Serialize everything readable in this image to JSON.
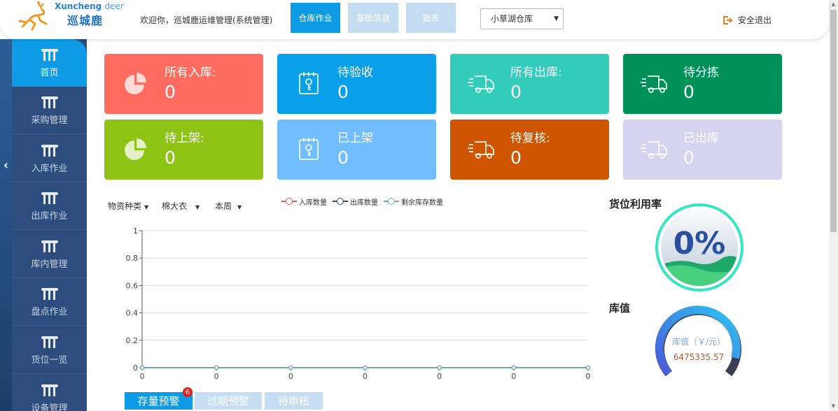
{
  "header": {
    "logo_en": "Xuncheng",
    "logo_en2": "deer",
    "logo_cn": "巡城鹿",
    "welcome": "欢迎你，巡城鹿运维管理(系统管理)",
    "nav": [
      "仓库作业",
      "基础信息",
      "报表"
    ],
    "warehouse": "小草湖仓库",
    "logout": "安全退出"
  },
  "sidebar": {
    "items": [
      "首页",
      "采购管理",
      "入库作业",
      "出库作业",
      "库内管理",
      "盘点作业",
      "货位一览",
      "设备管理"
    ]
  },
  "cards": [
    {
      "label": "所有入库:",
      "value": "0",
      "color": "#ff6b5e",
      "icon": "pie-chart-icon"
    },
    {
      "label": "待验收",
      "value": "0",
      "color": "#0aa0e9",
      "icon": "clipboard-key-icon"
    },
    {
      "label": "所有出库:",
      "value": "0",
      "color": "#33ccbb",
      "icon": "truck-icon"
    },
    {
      "label": "待分拣",
      "value": "0",
      "color": "#00905a",
      "icon": "truck-icon"
    },
    {
      "label": "待上架:",
      "value": "0",
      "color": "#8cc314",
      "icon": "pie-chart-icon"
    },
    {
      "label": "已上架",
      "value": "0",
      "color": "#70bdff",
      "icon": "clipboard-key-icon"
    },
    {
      "label": "待复核:",
      "value": "0",
      "color": "#cf5500",
      "icon": "truck-icon"
    },
    {
      "label": "已出库",
      "value": "0",
      "color": "#d6d3f0",
      "icon": "truck-icon"
    }
  ],
  "filters": {
    "category": "物资种类",
    "item": "棉大衣",
    "period": "本周"
  },
  "chart_data": {
    "type": "line",
    "x": [
      "0",
      "0",
      "0",
      "0",
      "0",
      "0",
      "0"
    ],
    "series": [
      {
        "name": "入库数量",
        "values": [
          0,
          0,
          0,
          0,
          0,
          0,
          0
        ],
        "color": "#e05555"
      },
      {
        "name": "出库数量",
        "values": [
          0,
          0,
          0,
          0,
          0,
          0,
          0
        ],
        "color": "#3a4a66"
      },
      {
        "name": "剩余库存数量",
        "values": [
          0,
          0,
          0,
          0,
          0,
          0,
          0
        ],
        "color": "#6aa9b5"
      }
    ],
    "yticks": [
      "0",
      "0.2",
      "0.4",
      "0.6",
      "0.8",
      "1"
    ],
    "ylim": [
      0,
      1
    ],
    "grid": true,
    "legend": "top"
  },
  "bottom_tabs": {
    "items": [
      "存量预警",
      "过期预警",
      "待审核"
    ],
    "badge": "6"
  },
  "right": {
    "util_title": "货位利用率",
    "util_value": "0%",
    "util_fraction": 0,
    "value_title": "库值",
    "value_label": "库值（￥/元）",
    "value_amount": "6475335.57"
  }
}
